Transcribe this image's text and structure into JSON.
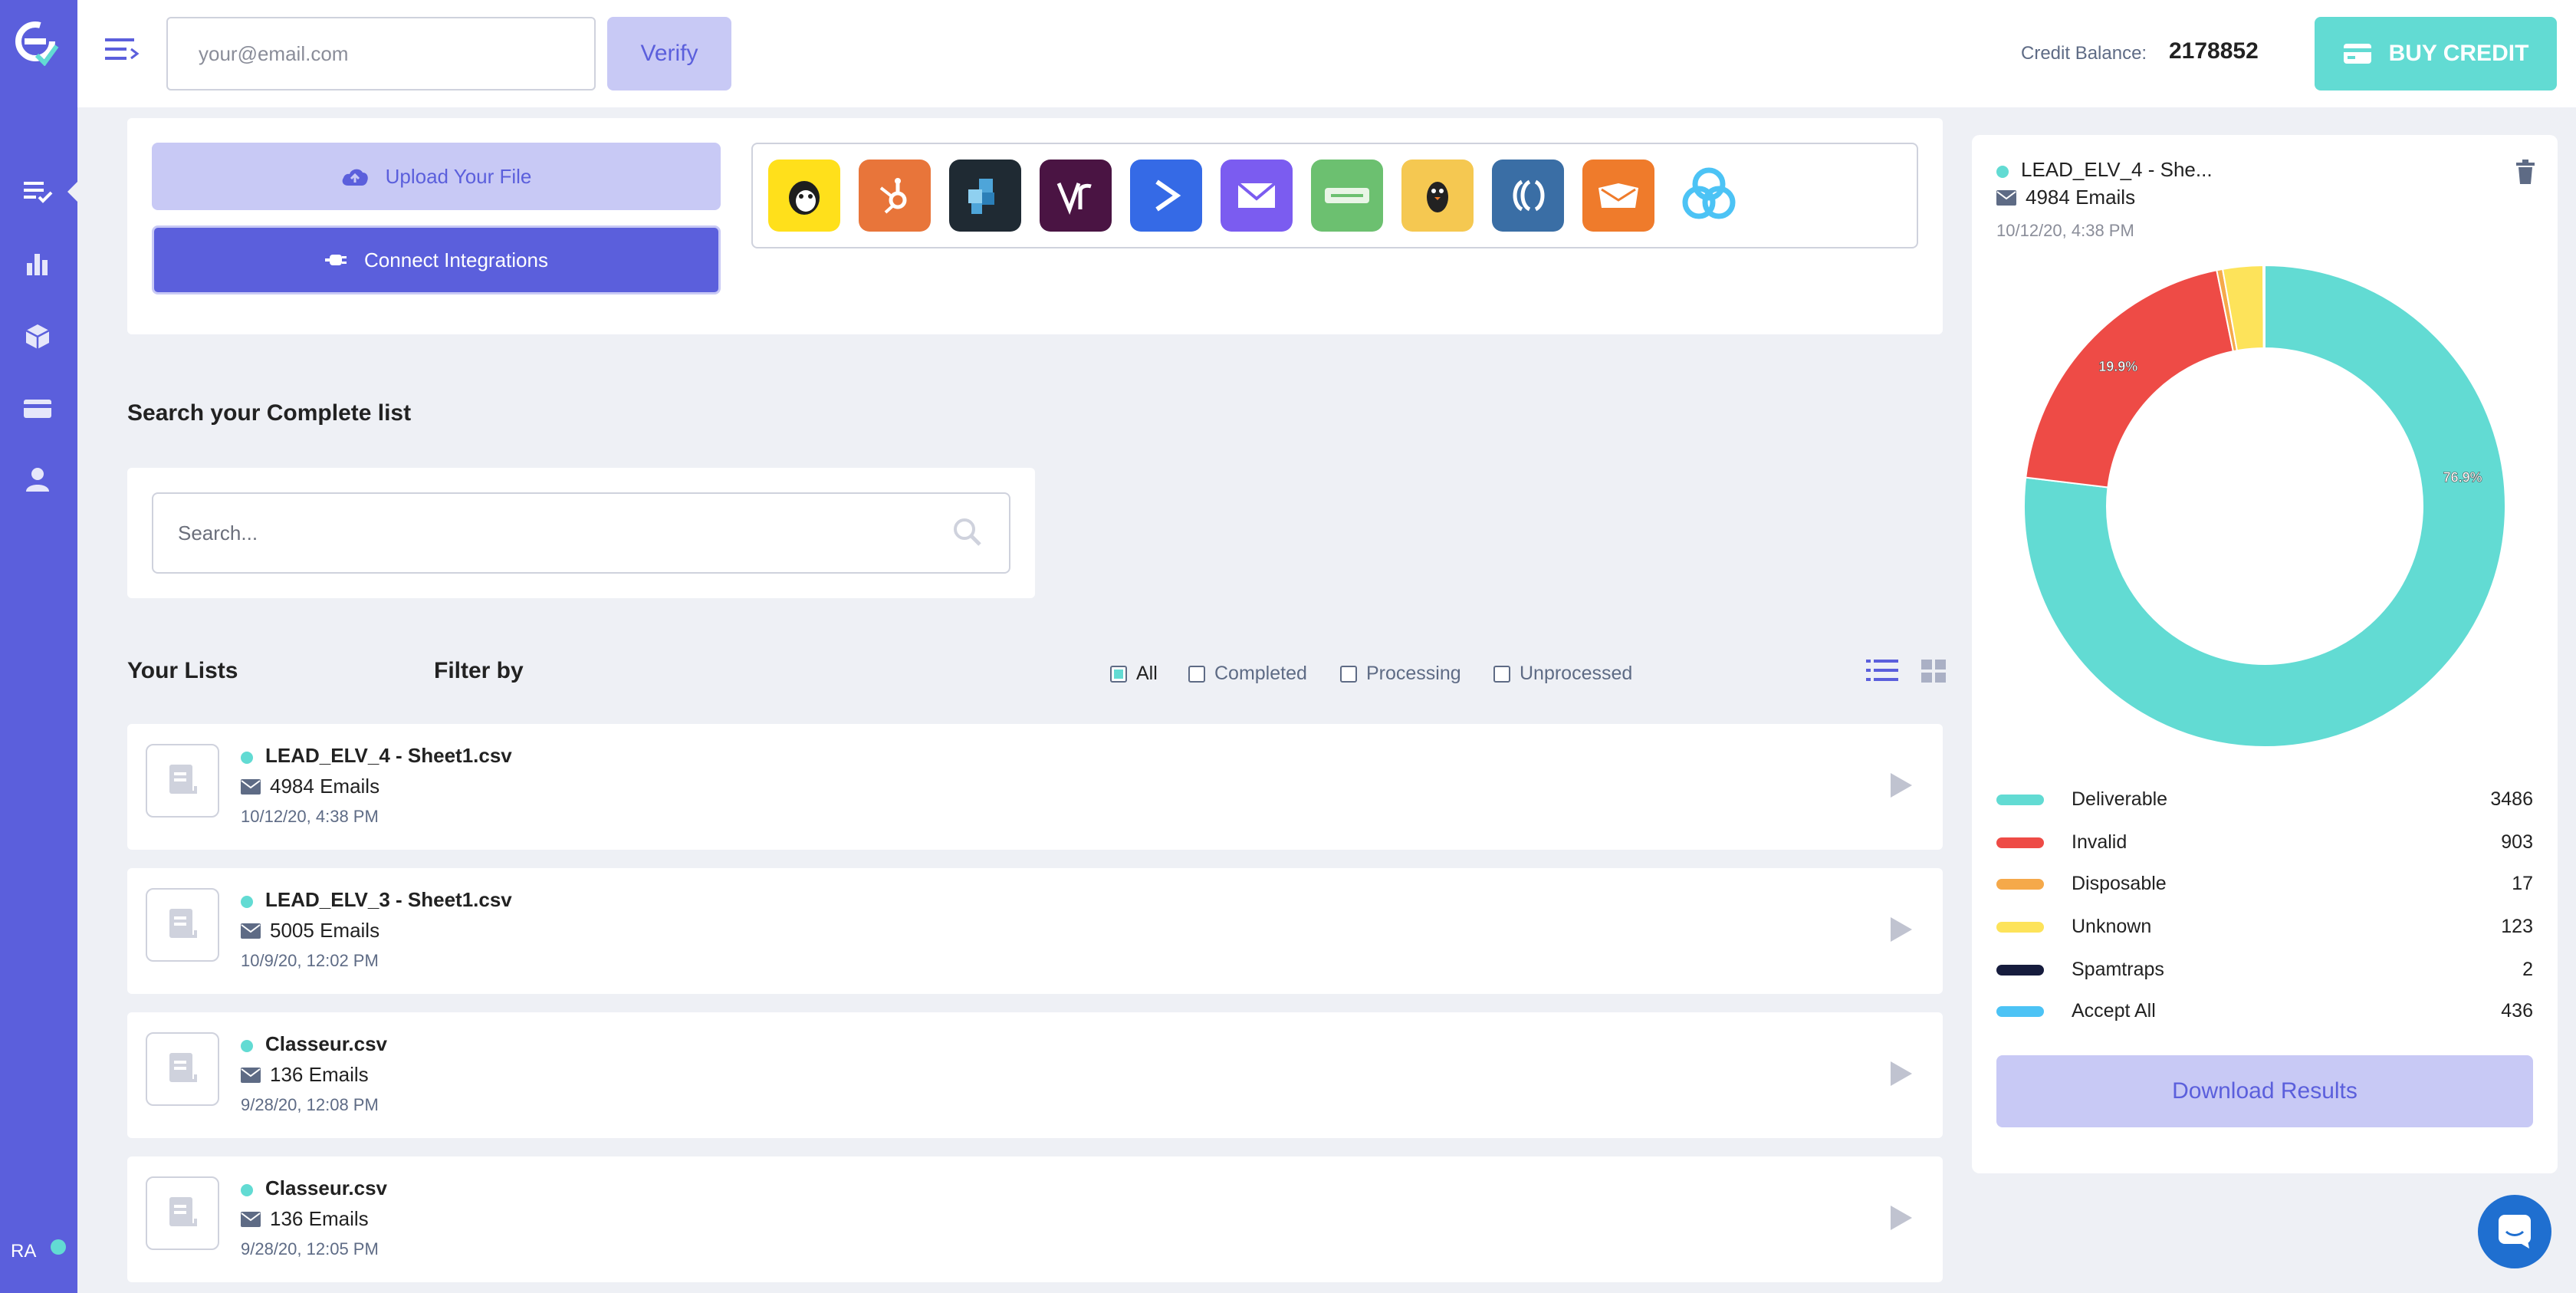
{
  "sidebar": {
    "logo": "emailable-logo-icon",
    "items": [
      {
        "icon": "list-check-icon",
        "active": true
      },
      {
        "icon": "bar-chart-icon"
      },
      {
        "icon": "cube-icon"
      },
      {
        "icon": "credit-card-icon"
      },
      {
        "icon": "user-icon"
      }
    ],
    "user_initials": "RA"
  },
  "header": {
    "email_placeholder": "your@email.com",
    "verify_label": "Verify",
    "credit_label": "Credit Balance:",
    "credit_value": "2178852",
    "buy_label": "BUY CREDIT"
  },
  "upload": {
    "upload_label": "Upload Your File",
    "connect_label": "Connect Integrations",
    "integrations": [
      {
        "name": "mailchimp-icon",
        "bg": "#ffe01b"
      },
      {
        "name": "hubspot-icon",
        "bg": "#e8753a"
      },
      {
        "name": "squares-icon",
        "bg": "#1f2a33"
      },
      {
        "name": "vr-icon",
        "bg": "#4a1443"
      },
      {
        "name": "activecampaign-icon",
        "bg": "#356ae6"
      },
      {
        "name": "mail-envelope-icon",
        "bg": "#7b5cf0"
      },
      {
        "name": "chat-green-icon",
        "bg": "#6cc070"
      },
      {
        "name": "penguin-icon",
        "bg": "#f5c851"
      },
      {
        "name": "convertkit-icon",
        "bg": "#3a6ea5"
      },
      {
        "name": "mailwizz-icon",
        "bg": "#ef7b2b"
      },
      {
        "name": "knot-icon",
        "bg": "#ffffff"
      }
    ]
  },
  "search": {
    "title": "Search your Complete list",
    "placeholder": "Search..."
  },
  "lists": {
    "title": "Your Lists",
    "filter_title": "Filter by",
    "filters": [
      {
        "label": "All",
        "checked": true
      },
      {
        "label": "Completed",
        "checked": false
      },
      {
        "label": "Processing",
        "checked": false
      },
      {
        "label": "Unprocessed",
        "checked": false
      }
    ],
    "items": [
      {
        "name": "LEAD_ELV_4 - Sheet1.csv",
        "emails": "4984 Emails",
        "date": "10/12/20, 4:38 PM"
      },
      {
        "name": "LEAD_ELV_3 - Sheet1.csv",
        "emails": "5005 Emails",
        "date": "10/9/20, 12:02 PM"
      },
      {
        "name": "Classeur.csv",
        "emails": "136 Emails",
        "date": "9/28/20, 12:08 PM"
      },
      {
        "name": "Classeur.csv",
        "emails": "136 Emails",
        "date": "9/28/20, 12:05 PM"
      }
    ]
  },
  "detail": {
    "name": "LEAD_ELV_4 - She...",
    "emails": "4984 Emails",
    "date": "10/12/20, 4:38 PM",
    "download_label": "Download Results",
    "legend": [
      {
        "label": "Deliverable",
        "value": "3486",
        "color": "#62dbd3"
      },
      {
        "label": "Invalid",
        "value": "903",
        "color": "#ee4b46"
      },
      {
        "label": "Disposable",
        "value": "17",
        "color": "#f5a94a"
      },
      {
        "label": "Unknown",
        "value": "123",
        "color": "#fde35a"
      },
      {
        "label": "Spamtraps",
        "value": "2",
        "color": "#161c3d"
      },
      {
        "label": "Accept All",
        "value": "436",
        "color": "#4cc3f5"
      }
    ]
  },
  "chart_data": {
    "type": "pie",
    "categories": [
      "Deliverable",
      "Invalid",
      "Disposable",
      "Unknown",
      "Spamtraps"
    ],
    "values": [
      76.9,
      19.9,
      0.4,
      2.7,
      0.1
    ],
    "data_labels": [
      "76.9%",
      "19.9%"
    ],
    "colors": [
      "#62dbd3",
      "#ee4b46",
      "#f5a94a",
      "#fde35a",
      "#161c3d"
    ]
  }
}
